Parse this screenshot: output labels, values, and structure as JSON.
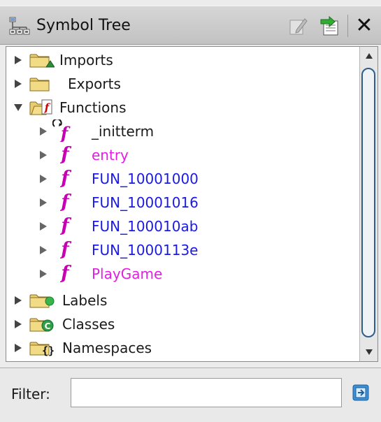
{
  "window": {
    "title": "Symbol Tree",
    "icons": [
      "symbol-tree-icon",
      "edit-icon",
      "navigate-icon",
      "close-icon"
    ],
    "close_glyph": "✕"
  },
  "tree": {
    "nodes": [
      {
        "label": "Imports",
        "icon": "imports-folder-icon",
        "expanded": false
      },
      {
        "label": "Exports",
        "icon": "exports-folder-icon",
        "expanded": false
      },
      {
        "label": "Functions",
        "icon": "functions-folder-icon",
        "expanded": true
      },
      {
        "label": "_initterm",
        "icon": "function-thunk-icon",
        "color": "#1a1ae6"
      },
      {
        "label": "entry",
        "icon": "function-icon",
        "color": "#e21ee2"
      },
      {
        "label": "FUN_10001000",
        "icon": "function-icon",
        "color": "#1a1ae6"
      },
      {
        "label": "FUN_10001016",
        "icon": "function-icon",
        "color": "#1a1ae6"
      },
      {
        "label": "FUN_100010ab",
        "icon": "function-icon",
        "color": "#1a1ae6"
      },
      {
        "label": "FUN_1000113e",
        "icon": "function-icon",
        "color": "#1a1ae6"
      },
      {
        "label": "PlayGame",
        "icon": "function-icon",
        "color": "#e21ee2"
      },
      {
        "label": "Labels",
        "icon": "labels-folder-icon",
        "expanded": false
      },
      {
        "label": "Classes",
        "icon": "classes-folder-icon",
        "expanded": false
      },
      {
        "label": "Namespaces",
        "icon": "namespaces-folder-icon",
        "expanded": false
      }
    ],
    "function_glyph": "f"
  },
  "filter": {
    "label": "Filter:",
    "value": ""
  },
  "colors": {
    "function_blue": "#1a1ae6",
    "function_magenta": "#e21ee2",
    "scroll_thumb_border": "#2f5d8a"
  }
}
